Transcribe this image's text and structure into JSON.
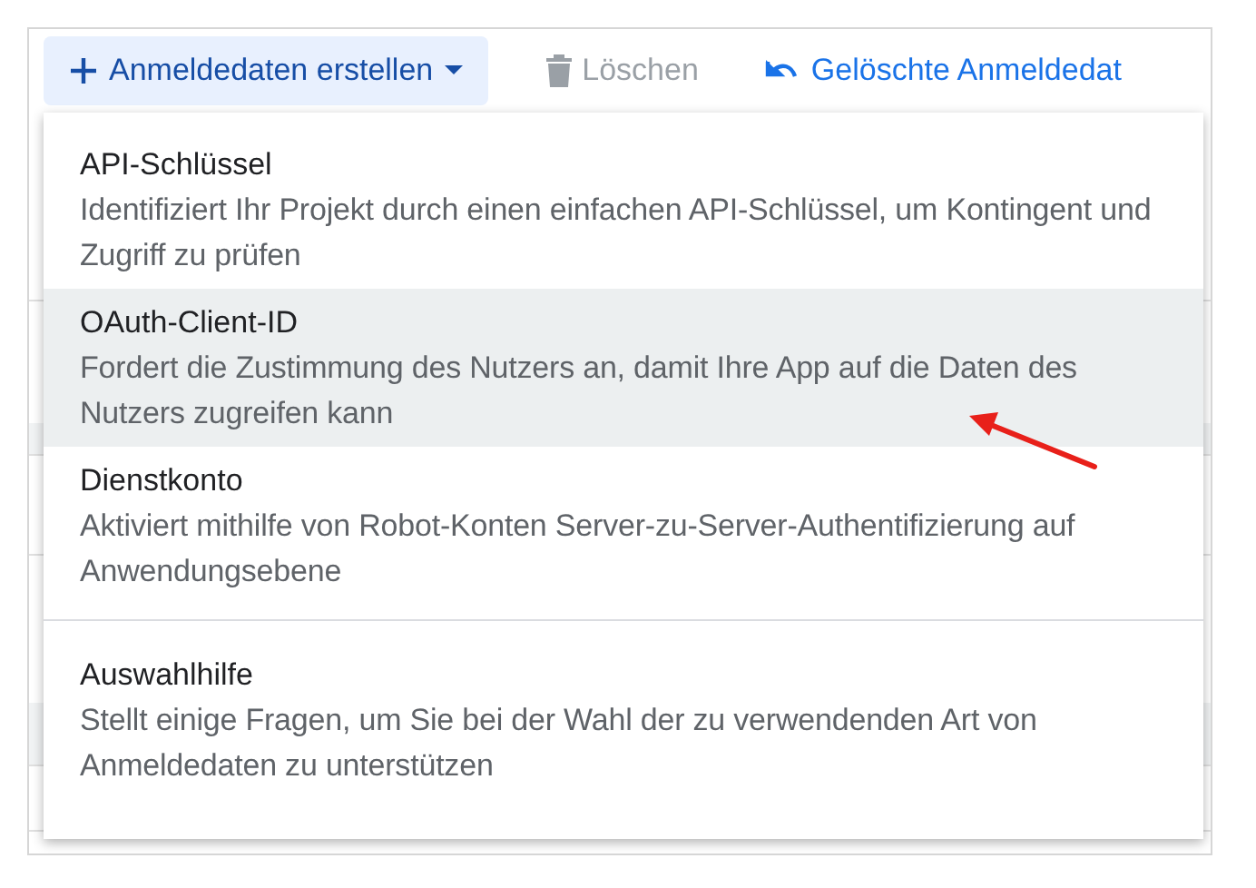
{
  "toolbar": [
    {
      "kind": "primary",
      "label": "Anmeldedaten erstellen"
    },
    {
      "kind": "disabled",
      "label": "Löschen"
    },
    {
      "kind": "link",
      "label": "Gelöschte Anmeldedat"
    }
  ],
  "background_rows": [
    {
      "kind": "row"
    },
    {
      "kind": "blank"
    },
    {
      "kind": "band"
    },
    {
      "kind": "row"
    },
    {
      "kind": "blank"
    },
    {
      "kind": "band"
    },
    {
      "kind": "row"
    }
  ],
  "menu_sections": [
    [
      {
        "title": "API-Schlüssel",
        "description": "Identifiziert Ihr Projekt durch einen einfachen API-Schlüssel, um Kontingent und Zugriff zu prüfen",
        "highlighted": false
      },
      {
        "title": "OAuth-Client-ID",
        "description": "Fordert die Zustimmung des Nutzers an, damit Ihre App auf die Daten des Nutzers zugreifen kann",
        "highlighted": true
      },
      {
        "title": "Dienstkonto",
        "description": "Aktiviert mithilfe von Robot-Konten Server-zu-Server-Authentifizierung auf Anwendungsebene",
        "highlighted": false
      }
    ],
    [
      {
        "title": "Auswahlhilfe",
        "description": "Stellt einige Fragen, um Sie bei der Wahl der zu verwendenden Art von Anmeldedaten zu unterstützen",
        "highlighted": false
      }
    ]
  ]
}
